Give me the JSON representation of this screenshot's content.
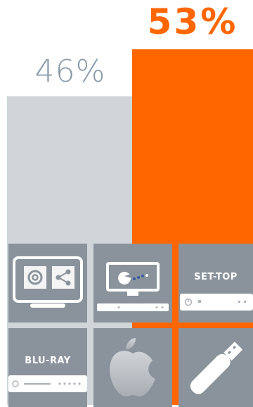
{
  "chart_data": {
    "type": "bar",
    "categories": [
      "",
      ""
    ],
    "values": [
      46,
      53
    ],
    "value_labels": [
      "46%",
      "53%"
    ],
    "colors": [
      "#cfd5d9",
      "#ff6600"
    ],
    "label_colors": [
      "#8a9aa8",
      "#ff6600"
    ],
    "ylim": [
      0,
      53
    ],
    "grid": false,
    "legend": "none",
    "title": "",
    "xlabel": "",
    "ylabel": ""
  },
  "tiles": {
    "color": "#8a939c",
    "items": [
      {
        "icon": "monitor-email-share-icon"
      },
      {
        "icon": "monitor-game-icon"
      },
      {
        "icon": "set-top-box-icon",
        "label": "SET-TOP"
      },
      {
        "icon": "blu-ray-player-icon",
        "label": "BLU-RAY"
      },
      {
        "icon": "apple-icon"
      },
      {
        "icon": "usb-stick-icon"
      }
    ]
  }
}
